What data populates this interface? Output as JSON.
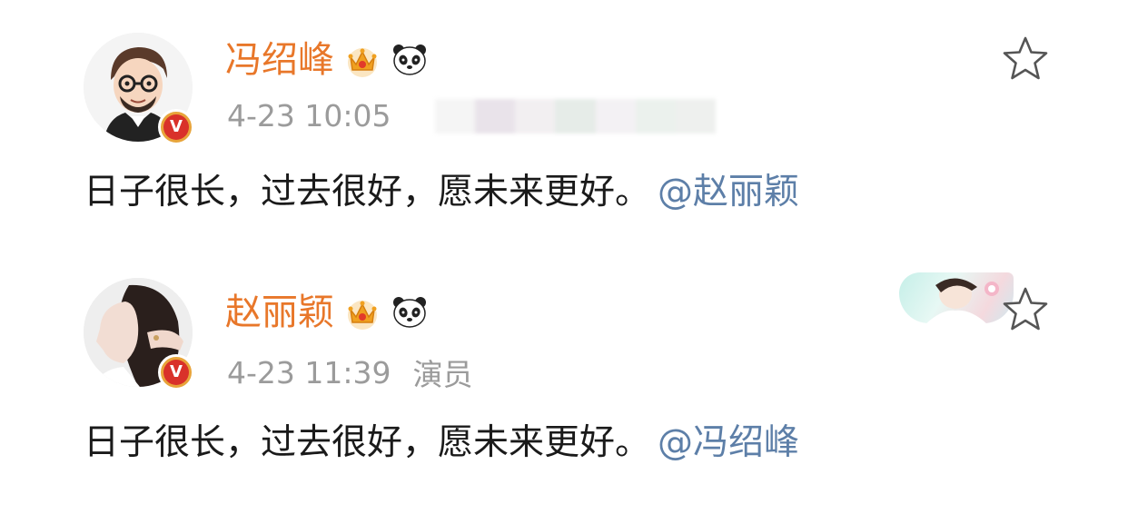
{
  "posts": [
    {
      "username": "冯绍峰",
      "timestamp": "4-23 10:05",
      "source": "",
      "content": "日子很长，过去很好，愿未来更好。",
      "mention": "@赵丽颖",
      "avatar_icon": "cartoon-avatar-icon",
      "badges": [
        "crown-icon",
        "panda-icon"
      ],
      "verified": true,
      "starred": false
    },
    {
      "username": "赵丽颖",
      "timestamp": "4-23 11:39",
      "source": "演员",
      "content": "日子很长，过去很好，愿未来更好。",
      "mention": "@冯绍峰",
      "avatar_icon": "photo-avatar-icon",
      "badges": [
        "crown-icon",
        "panda-icon"
      ],
      "verified": true,
      "starred": false
    }
  ],
  "verified_badge_letter": "V",
  "colors": {
    "username": "#e8772a",
    "meta": "#9b9b9b",
    "content": "#1a1a1a",
    "mention": "#5d7fa8",
    "verified_red": "#d9312a",
    "verified_ring": "#e8a43a"
  }
}
